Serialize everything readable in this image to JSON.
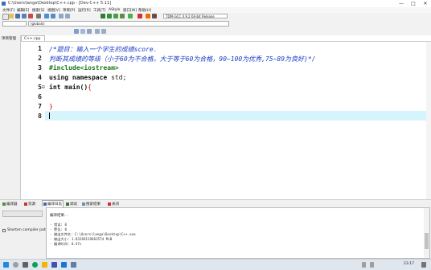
{
  "window": {
    "title": "C:\\Users\\lange\\Desktop\\C++.cpp - [Dev-C++ 5.11]",
    "controls": [
      "—",
      "□",
      "✕"
    ]
  },
  "menu": [
    "文件[F]",
    "编辑[E]",
    "搜索[S]",
    "视图[V]",
    "项目[P]",
    "运行[R]",
    "工具[T]",
    "AStyle",
    "窗口[W]",
    "帮助[H]"
  ],
  "toolbar": {
    "compiler": "TDM-GCC 4.9.2 64-bit Release"
  },
  "scope": {
    "class_combo": "(globals)"
  },
  "left_panel": {
    "tab_label": "项目管理"
  },
  "editor": {
    "file_tab": "C++.cpp",
    "lines": [
      "1",
      "2",
      "3",
      "4",
      "5",
      "6",
      "7",
      "8"
    ],
    "fold_marker": "⊟",
    "code": {
      "l1": "/*题目：输入一个学生的成绩score.",
      "l2": "判断其成绩的等级（小于60为不合格，大于等于60为合格，90~100为优秀,75~89为良好)*/",
      "l3": "#include<iostream>",
      "l4_kw": "using namespace",
      "l4_rest": " std;",
      "l5_kw": "int",
      "l5_name": " main()",
      "l5_brace": "{",
      "l7_brace": "}"
    }
  },
  "bottom_tabs": [
    "编译器",
    "资源",
    "编译日志",
    "调试",
    "搜索结果",
    "关闭"
  ],
  "bottom_left": {
    "shorten_label": "Shorten compiler paths"
  },
  "log": {
    "title": "编译结果...",
    "lines": [
      "- 错误: 0",
      "- 警告: 0",
      "- 输出文件名: C:\\Users\\lange\\Desktop\\C++.exe",
      "- 输出大小: 1.83269119663574 MiB",
      "- 编译时间: 0.47s"
    ]
  },
  "taskbar": {
    "time": "23:17"
  },
  "colors": {
    "comment": "#1a3cc8",
    "preprocessor": "#1a7a1a",
    "brace": "#d20000",
    "current_line": "#d6f4fb"
  }
}
